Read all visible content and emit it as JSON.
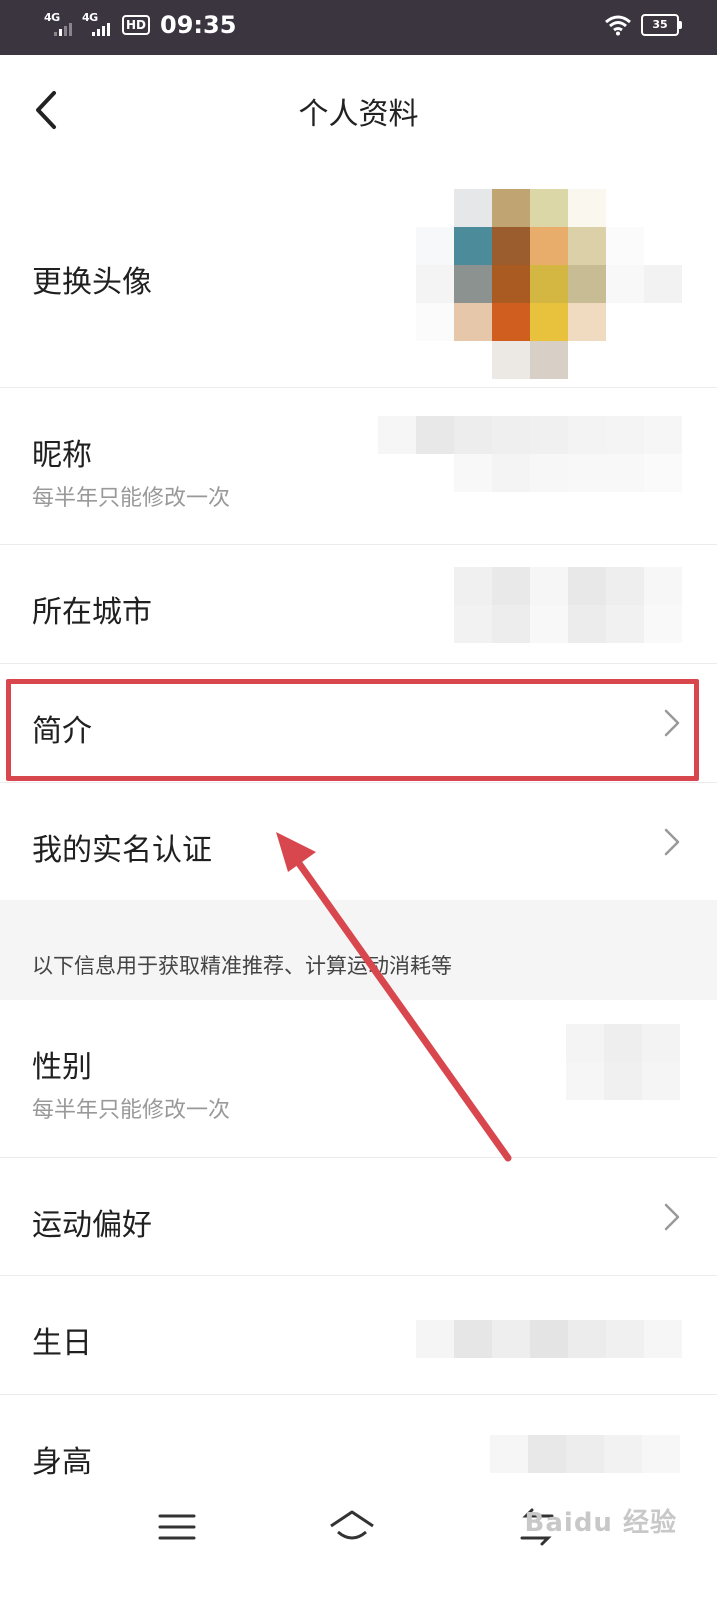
{
  "status_bar": {
    "net1": "4G",
    "net2": "4G",
    "hd": "HD",
    "time": "09:35",
    "battery": "35"
  },
  "header": {
    "title": "个人资料"
  },
  "rows": {
    "avatar": {
      "label": "更换头像"
    },
    "nickname": {
      "label": "昵称",
      "sub": "每半年只能修改一次"
    },
    "city": {
      "label": "所在城市"
    },
    "intro": {
      "label": "简介"
    },
    "realname": {
      "label": "我的实名认证"
    },
    "gender": {
      "label": "性别",
      "sub": "每半年只能修改一次"
    },
    "sport": {
      "label": "运动偏好"
    },
    "birthday": {
      "label": "生日"
    },
    "height": {
      "label": "身高"
    }
  },
  "section": {
    "text": "以下信息用于获取精准推荐、计算运动消耗等"
  },
  "watermark": "Baidu 经验",
  "colors": {
    "highlight": "#d9474e",
    "statusbar": "#3b3540"
  }
}
